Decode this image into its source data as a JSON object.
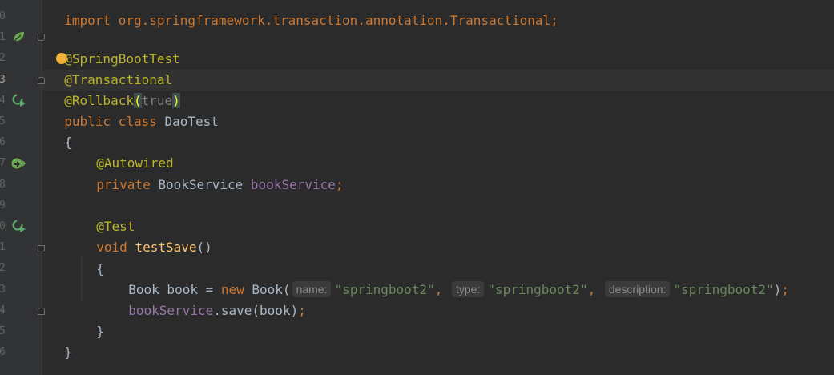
{
  "editor": {
    "top_partial_line": "import org.springframework.transaction.annotation.Transactional;",
    "line_numbers": [
      "0",
      "1",
      "2",
      "3",
      "4",
      "5",
      "6",
      "7",
      "8",
      "9",
      "0",
      "1",
      "2",
      "3",
      "4",
      "5",
      "6"
    ],
    "current_line_index": 3,
    "code": {
      "l1": "@SpringBootTest",
      "l2_at": "@",
      "l2_rest": "Transactional",
      "l3_ann": "@Rollback",
      "l3_open": "(",
      "l3_arg": "true",
      "l3_close": ")",
      "l4_kw": "public class ",
      "l4_name": "DaoTest",
      "l5": "{",
      "l6": "@Autowired",
      "l7_kw": "private ",
      "l7_type": "BookService ",
      "l7_field": "bookService",
      "l7_semi": ";",
      "l9": "@Test",
      "l10_kw": "void ",
      "l10_meth": "testSave",
      "l10_parens": "()",
      "l11": "{",
      "l12_type": "Book book = ",
      "l12_new": "new ",
      "l12_ctor": "Book(",
      "l12_hint1": "name:",
      "l12_str1": "\"springboot2\"",
      "l12_comma1": ", ",
      "l12_hint2": "type:",
      "l12_str2": "\"springboot2\"",
      "l12_comma2": ", ",
      "l12_hint3": "description:",
      "l12_str3": "\"springboot2\"",
      "l12_close": ")",
      "l12_semi": ";",
      "l13_field": "bookService",
      "l13_call": ".save(book)",
      "l13_semi": ";",
      "l14": "}",
      "l15": "}"
    }
  },
  "colors": {
    "background": "#2b2b2b",
    "annotation": "#bbb529",
    "keyword": "#cc7832",
    "field": "#9876aa",
    "string": "#6a8759",
    "method": "#ffc66d",
    "spring_icon": "#6aa84f"
  },
  "icons": [
    "spring-bean-icon",
    "run-test-class-icon",
    "autowired-bean-icon",
    "run-test-method-icon",
    "fold-marker-icon",
    "intention-bulb-icon"
  ]
}
